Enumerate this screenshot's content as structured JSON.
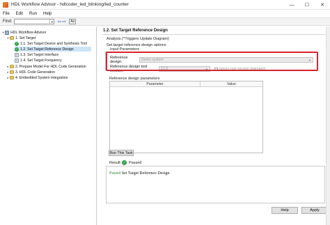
{
  "window": {
    "title": "HDL Workflow Advisor - hdlcoder_led_blinking/led_counter",
    "minimize": "—",
    "maximize": "☐",
    "close": "✕"
  },
  "menu": {
    "file": "File",
    "edit": "Edit",
    "run": "Run",
    "help": "Help"
  },
  "find": {
    "label": "Find:",
    "value": "",
    "aa": "Aa"
  },
  "tree": [
    {
      "label": "HDL Workflow Advisor",
      "icon": "advisor-icon"
    },
    {
      "label": "1. Set Target",
      "icon": "folder-icon"
    },
    {
      "label": "1.1. Set Target Device and Synthesis Tool",
      "icon": "check-icon"
    },
    {
      "label": "1.2. Set Target Reference Design",
      "icon": "check-icon"
    },
    {
      "label": "1.3. Set Target Interface",
      "icon": "task-icon"
    },
    {
      "label": "1.4. Set Target Frequency",
      "icon": "task-icon"
    },
    {
      "label": "2. Prepare Model For HDL Code Generation",
      "icon": "folder-icon"
    },
    {
      "label": "3. HDL Code Generation",
      "icon": "folder-icon"
    },
    {
      "label": "4. Embedded System Integration",
      "icon": "folder-icon"
    }
  ],
  "task": {
    "header": "1.2. Set Target Reference Design",
    "analysis": "Analysis (^Triggers Update Diagram)",
    "subtitle": "Set target reference design options",
    "input_group": "Input Parameters",
    "reference_design_label": "Reference design:",
    "reference_design_value": "Demo system",
    "tool_version_label": "Reference design tool version:",
    "tool_version_value": "17.0",
    "ignore_mismatch_label": "Ignore tool version mismatch",
    "params_title": "Reference design parameters",
    "col_parameter": "Parameter",
    "col_value": "Value",
    "run_button": "Run This Task",
    "result_label": "Result:",
    "result_status": "Passed",
    "output_passed": "Passed",
    "output_text": " Set Target Reference Design",
    "help_button": "Help",
    "apply_button": "Apply"
  },
  "colors": {
    "highlight": "#d9232d",
    "passed": "#2ea043",
    "selection": "#cde4f7"
  }
}
